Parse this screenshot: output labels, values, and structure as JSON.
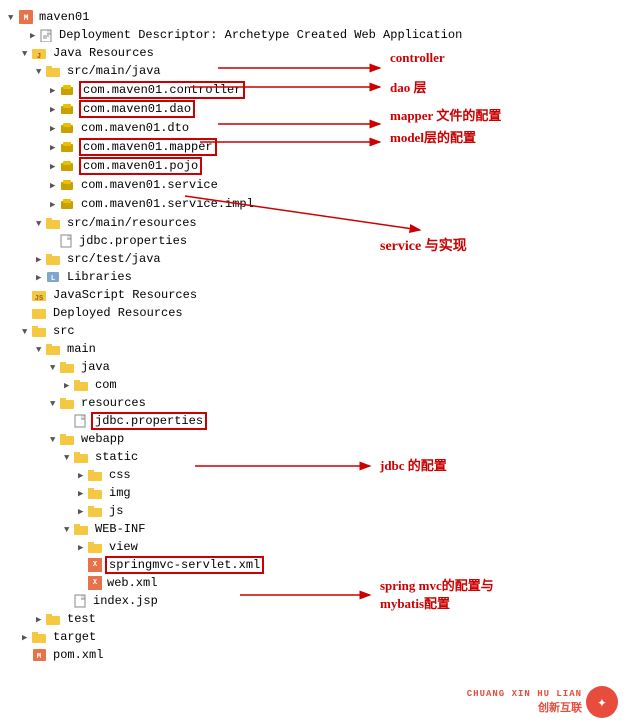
{
  "tree": {
    "root": "maven01",
    "items": [
      {
        "id": "maven01",
        "label": "maven01",
        "indent": 0,
        "type": "project",
        "expanded": true
      },
      {
        "id": "deployment",
        "label": "Deployment Descriptor: Archetype Created Web Application",
        "indent": 1,
        "type": "descriptor",
        "expanded": false
      },
      {
        "id": "java-resources",
        "label": "Java Resources",
        "indent": 1,
        "type": "java-resources",
        "expanded": true
      },
      {
        "id": "src-main-java",
        "label": "src/main/java",
        "indent": 2,
        "type": "folder",
        "expanded": true
      },
      {
        "id": "controller",
        "label": "com.maven01.controller",
        "indent": 3,
        "type": "package",
        "expanded": false,
        "highlight": true
      },
      {
        "id": "dao",
        "label": "com.maven01.dao",
        "indent": 3,
        "type": "package",
        "expanded": false,
        "highlight": true
      },
      {
        "id": "dto",
        "label": "com.maven01.dto",
        "indent": 3,
        "type": "package",
        "expanded": false
      },
      {
        "id": "mapper",
        "label": "com.maven01.mapper",
        "indent": 3,
        "type": "package",
        "expanded": false,
        "highlight": true
      },
      {
        "id": "pojo",
        "label": "com.maven01.pojo",
        "indent": 3,
        "type": "package",
        "expanded": false,
        "highlight": true
      },
      {
        "id": "service",
        "label": "com.maven01.service",
        "indent": 3,
        "type": "package",
        "expanded": false
      },
      {
        "id": "service-impl",
        "label": "com.maven01.service.impl",
        "indent": 3,
        "type": "package",
        "expanded": false
      },
      {
        "id": "src-main-resources",
        "label": "src/main/resources",
        "indent": 2,
        "type": "folder",
        "expanded": true
      },
      {
        "id": "jdbc-properties-1",
        "label": "jdbc.properties",
        "indent": 3,
        "type": "file"
      },
      {
        "id": "src-test-java",
        "label": "src/test/java",
        "indent": 2,
        "type": "folder",
        "expanded": false
      },
      {
        "id": "libraries",
        "label": "Libraries",
        "indent": 2,
        "type": "library",
        "expanded": false
      },
      {
        "id": "js-resources",
        "label": "JavaScript Resources",
        "indent": 1,
        "type": "js-resources"
      },
      {
        "id": "deployed",
        "label": "Deployed Resources",
        "indent": 1,
        "type": "deployed"
      },
      {
        "id": "src",
        "label": "src",
        "indent": 1,
        "type": "folder",
        "expanded": true
      },
      {
        "id": "main",
        "label": "main",
        "indent": 2,
        "type": "folder",
        "expanded": true
      },
      {
        "id": "java",
        "label": "java",
        "indent": 3,
        "type": "folder",
        "expanded": true
      },
      {
        "id": "com",
        "label": "com",
        "indent": 4,
        "type": "folder",
        "expanded": false
      },
      {
        "id": "resources-2",
        "label": "resources",
        "indent": 3,
        "type": "folder",
        "expanded": true
      },
      {
        "id": "jdbc-properties-2",
        "label": "jdbc.properties",
        "indent": 4,
        "type": "file",
        "highlight": true
      },
      {
        "id": "webapp",
        "label": "webapp",
        "indent": 3,
        "type": "folder",
        "expanded": true
      },
      {
        "id": "static",
        "label": "static",
        "indent": 4,
        "type": "folder",
        "expanded": true
      },
      {
        "id": "css",
        "label": "css",
        "indent": 5,
        "type": "folder",
        "expanded": false
      },
      {
        "id": "img",
        "label": "img",
        "indent": 5,
        "type": "folder",
        "expanded": false
      },
      {
        "id": "js",
        "label": "js",
        "indent": 5,
        "type": "folder",
        "expanded": false
      },
      {
        "id": "webinf",
        "label": "WEB-INF",
        "indent": 4,
        "type": "folder",
        "expanded": true
      },
      {
        "id": "view",
        "label": "view",
        "indent": 5,
        "type": "folder",
        "expanded": false
      },
      {
        "id": "springmvc",
        "label": "springmvc-servlet.xml",
        "indent": 5,
        "type": "xml",
        "highlight": true
      },
      {
        "id": "webxml",
        "label": "web.xml",
        "indent": 5,
        "type": "xml"
      },
      {
        "id": "indexjsp",
        "label": "index.jsp",
        "indent": 4,
        "type": "file"
      },
      {
        "id": "test",
        "label": "test",
        "indent": 2,
        "type": "folder",
        "expanded": false
      },
      {
        "id": "target",
        "label": "target",
        "indent": 1,
        "type": "folder",
        "expanded": false
      },
      {
        "id": "pomxml",
        "label": "pom.xml",
        "indent": 1,
        "type": "xml-m"
      }
    ]
  },
  "annotations": {
    "controller": "controller",
    "dao": "dao 层",
    "mapper": "mapper 文件的配置",
    "model": "model层的配置",
    "service": "service 与实现",
    "jdbc": "jdbc 的配置",
    "springmvc": "spring mvc的配置与\nmybatis配置"
  },
  "logo": {
    "text": "创新互联",
    "subtext": "CHUANG XIN HU LIAN"
  }
}
